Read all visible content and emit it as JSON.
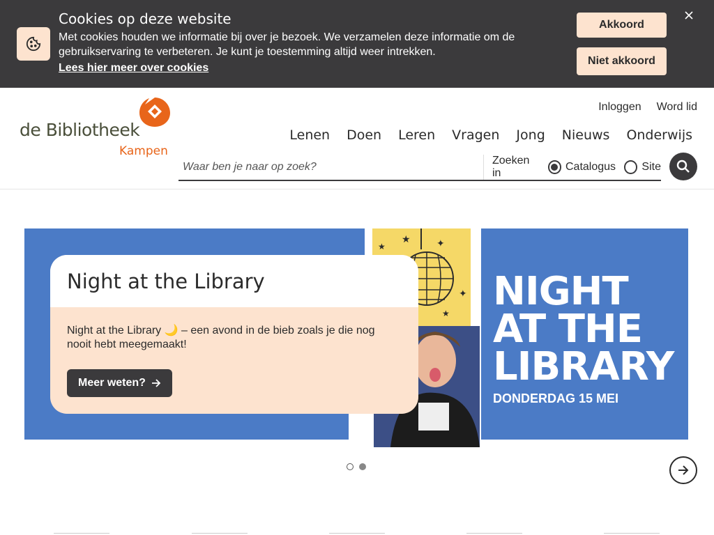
{
  "cookie_banner": {
    "title": "Cookies op deze website",
    "text": "Met cookies houden we informatie bij over je bezoek. We verzamelen deze informatie om de gebruikservaring te verbeteren. Je kunt je toestemming altijd weer intrekken.",
    "link": "Lees hier meer over cookies",
    "accept_label": "Akkoord",
    "decline_label": "Niet akkoord",
    "close_icon": "close-icon",
    "icon": "cookie-icon"
  },
  "logo": {
    "line1": "de Bibliotheek",
    "line2": "Kampen",
    "brand_color": "#e8651a"
  },
  "top_links": [
    "Inloggen",
    "Word lid"
  ],
  "nav": [
    "Lenen",
    "Doen",
    "Leren",
    "Vragen",
    "Jong",
    "Nieuws",
    "Onderwijs"
  ],
  "search": {
    "placeholder": "Waar ben je naar op zoek?",
    "scope_label": "Zoeken in",
    "options": [
      {
        "label": "Catalogus",
        "checked": true
      },
      {
        "label": "Site",
        "checked": false
      }
    ],
    "button_icon": "search-icon"
  },
  "hero": {
    "card_title": "Night at the Library",
    "card_text": "Night at the Library 🌙 – een avond in de bieb zoals je die nog nooit hebt meegemaakt!",
    "card_button": "Meer weten?",
    "banner_line1": "NIGHT",
    "banner_line2": "AT THE",
    "banner_line3": "LIBRARY",
    "banner_date": "DONDERDAG 15 MEI",
    "slide_count": 2,
    "active_slide": 1
  },
  "colors": {
    "dark": "#3b3a3c",
    "peach": "#fde3cf",
    "blue": "#4b7bc6",
    "yellow": "#f5d867",
    "orange": "#e8651a"
  }
}
